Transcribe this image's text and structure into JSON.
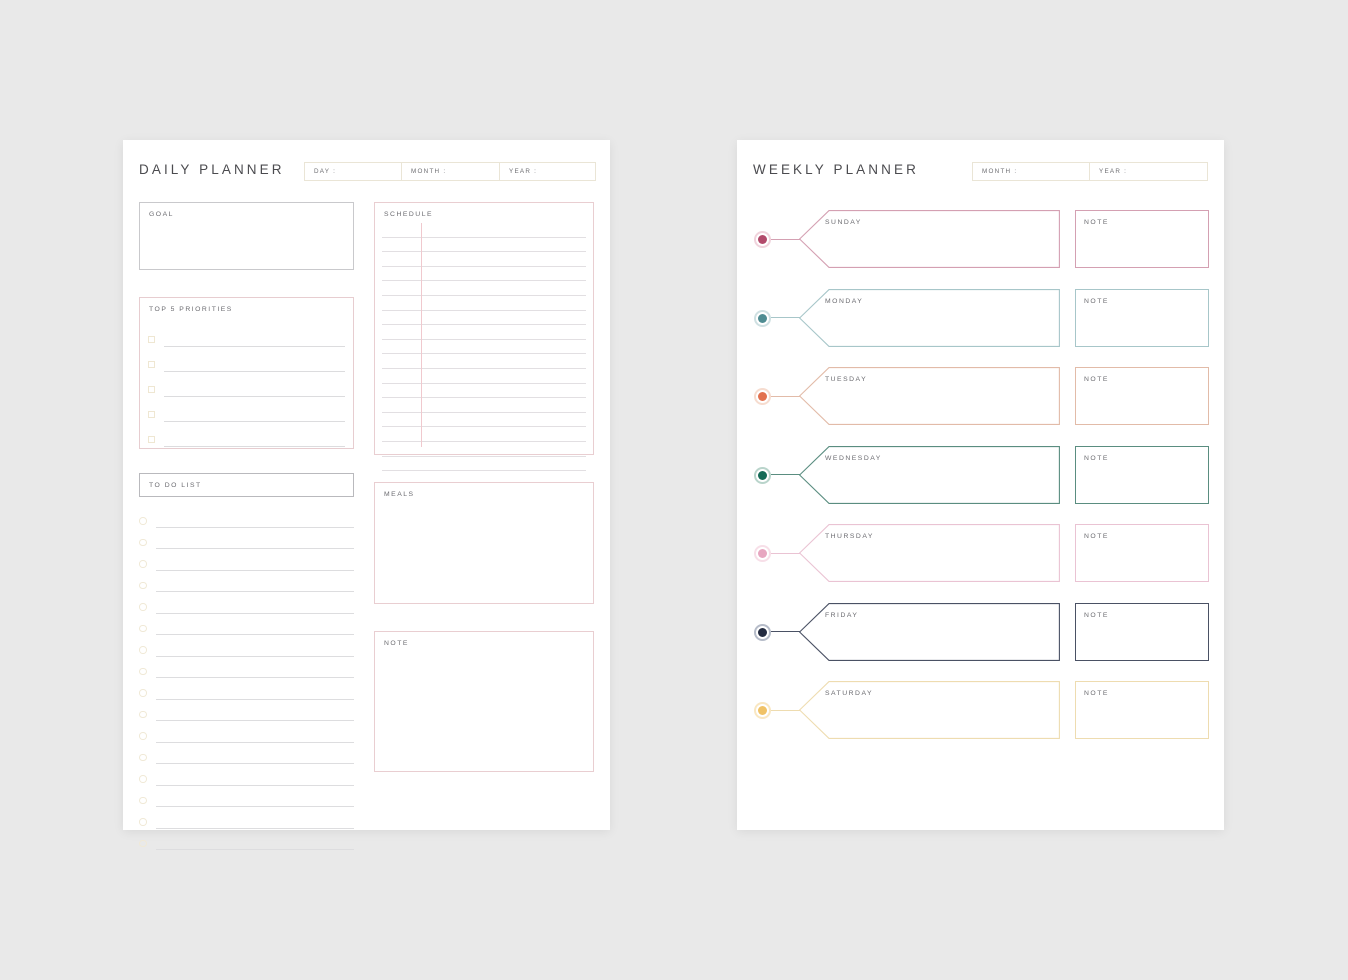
{
  "canvas": {
    "background": "#e9e9e9"
  },
  "daily": {
    "title": "DAILY PLANNER",
    "fields": [
      {
        "label": "DAY :",
        "name": "day"
      },
      {
        "label": "MONTH :",
        "name": "month"
      },
      {
        "label": "YEAR :",
        "name": "year"
      }
    ],
    "goal": {
      "label": "GOAL",
      "border": "#c9c9cc"
    },
    "priorities": {
      "label": "TOP 5 PRIORITIES",
      "border": "#e7cdd0",
      "rows": 5
    },
    "todo": {
      "label": "TO DO LIST",
      "border": "#b9b9bd",
      "rows": 16
    },
    "schedule": {
      "label": "SCHEDULE",
      "border": "#e9ced1",
      "lines": 17,
      "rule_color": "#f0c9ce"
    },
    "meals": {
      "label": "MEALS",
      "border": "#e9ced1"
    },
    "note": {
      "label": "NOTE",
      "border": "#e9ced1"
    }
  },
  "weekly": {
    "title": "WEEKLY PLANNER",
    "fields": [
      {
        "label": "MONTH :",
        "name": "month"
      },
      {
        "label": "YEAR :",
        "name": "year"
      }
    ],
    "note_label": "NOTE",
    "days": [
      {
        "label": "SUNDAY",
        "dot": "#b24a6b",
        "ring": "#f0d3dc",
        "line": "#d4a0b2"
      },
      {
        "label": "MONDAY",
        "dot": "#4f8c92",
        "ring": "#cfe0e2",
        "line": "#a7c6c9"
      },
      {
        "label": "TUESDAY",
        "dot": "#e2714f",
        "ring": "#f6dccf",
        "line": "#e2bba8"
      },
      {
        "label": "WEDNESDAY",
        "dot": "#156b57",
        "ring": "#b9d4cb",
        "line": "#5a8d80"
      },
      {
        "label": "THURSDAY",
        "dot": "#e7a6c0",
        "ring": "#f7dfe8",
        "line": "#eac3d3"
      },
      {
        "label": "FRIDAY",
        "dot": "#232b40",
        "ring": "#b6bcc9",
        "line": "#4a5164"
      },
      {
        "label": "SATURDAY",
        "dot": "#f0c266",
        "ring": "#f9e7c2",
        "line": "#eedcb0"
      }
    ]
  }
}
